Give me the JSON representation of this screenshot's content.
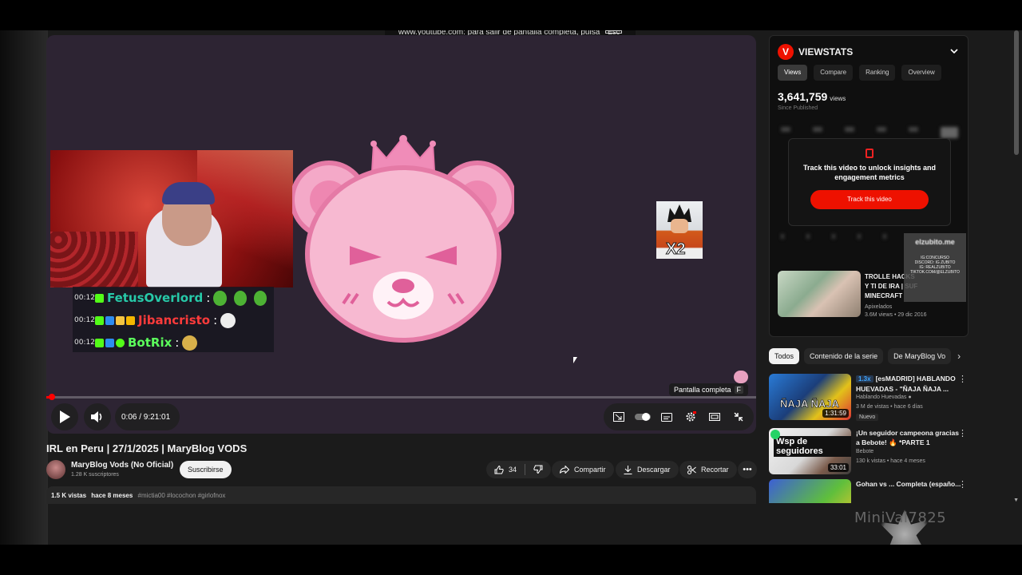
{
  "fullscreen_toast": {
    "text": "www.youtube.com: para salir de pantalla completa, pulsa",
    "key": "Esc"
  },
  "player": {
    "chat": [
      {
        "time": "00:12",
        "name": "FetusOverlord",
        "color": "#27c9a8"
      },
      {
        "time": "00:12",
        "name": "Jibancristo",
        "color": "#ff3b3b"
      },
      {
        "time": "00:12",
        "name": "BotRix",
        "color": "#5cff5c"
      }
    ],
    "overlay_text": "X2",
    "tooltip": {
      "label": "Pantalla completa",
      "key": "F"
    },
    "time_display": "0:06 / 9:21:01",
    "progress_fraction": 0.0107
  },
  "video": {
    "title": "IRL en Peru | 27/1/2025 | MaryBlog VODS",
    "channel": "MaryBlog Vods (No Oficial)",
    "subscribers": "1.28 K suscriptores",
    "subscribe_label": "Suscribirse",
    "likes": "34",
    "share_label": "Compartir",
    "download_label": "Descargar",
    "clip_label": "Recortar",
    "views": "1.5 K vistas",
    "age": "hace 8 meses",
    "tags": "#mictia00 #locochon #girlofnox"
  },
  "viewstats": {
    "logo": "V",
    "brand": "VIEWSTATS",
    "tabs": [
      "Views",
      "Compare",
      "Ranking",
      "Overview"
    ],
    "active_tab": "Views",
    "count": "3,641,759",
    "count_unit": "views",
    "since": "Since Published",
    "lock_text": "Track this video to unlock insights and engagement metrics",
    "track_button": "Track this video",
    "promo_video": {
      "title": "TROLLE HACKS Y TI DE IRA | SUF MINECRAFT",
      "channel": "Apixelados",
      "meta": "3.6M views • 29 dic 2016"
    },
    "overlay_card": {
      "big": "elzubito.me",
      "line1": "IG:CONCURSO",
      "line2": "DISCORD: IG ZUBITO",
      "line3": "IG: REALZUBITO",
      "line4": "TIKTOK.COM/@ELZUBITO"
    }
  },
  "chips": [
    "Todos",
    "Contenido de la serie",
    "De MaryBlog Vo"
  ],
  "recommended": [
    {
      "speed": "1.3x",
      "title": "[esMADRID] HABLANDO HUEVADAS - \"ÑAJA ÑAJA ...",
      "channel": "Hablando Huevadas",
      "meta": "3 M de vistas • hace 6 días",
      "duration": "1:31:59",
      "badge": "Nuevo",
      "thumb_text": "ÑAJA ÑAJA"
    },
    {
      "title": "¡Un seguidor campeona gracias a Bebote! 🔥 *PARTE 1",
      "channel": "Bebote",
      "meta": "130 k vistas • hace 4 meses",
      "duration": "33:01",
      "thumb_text": "Wsp de seguidores"
    },
    {
      "title": "Gohan vs ... Completa (españo...",
      "channel": "",
      "meta": "",
      "duration": "",
      "thumb_text": ""
    }
  ],
  "watermark": "MiniVal7825"
}
